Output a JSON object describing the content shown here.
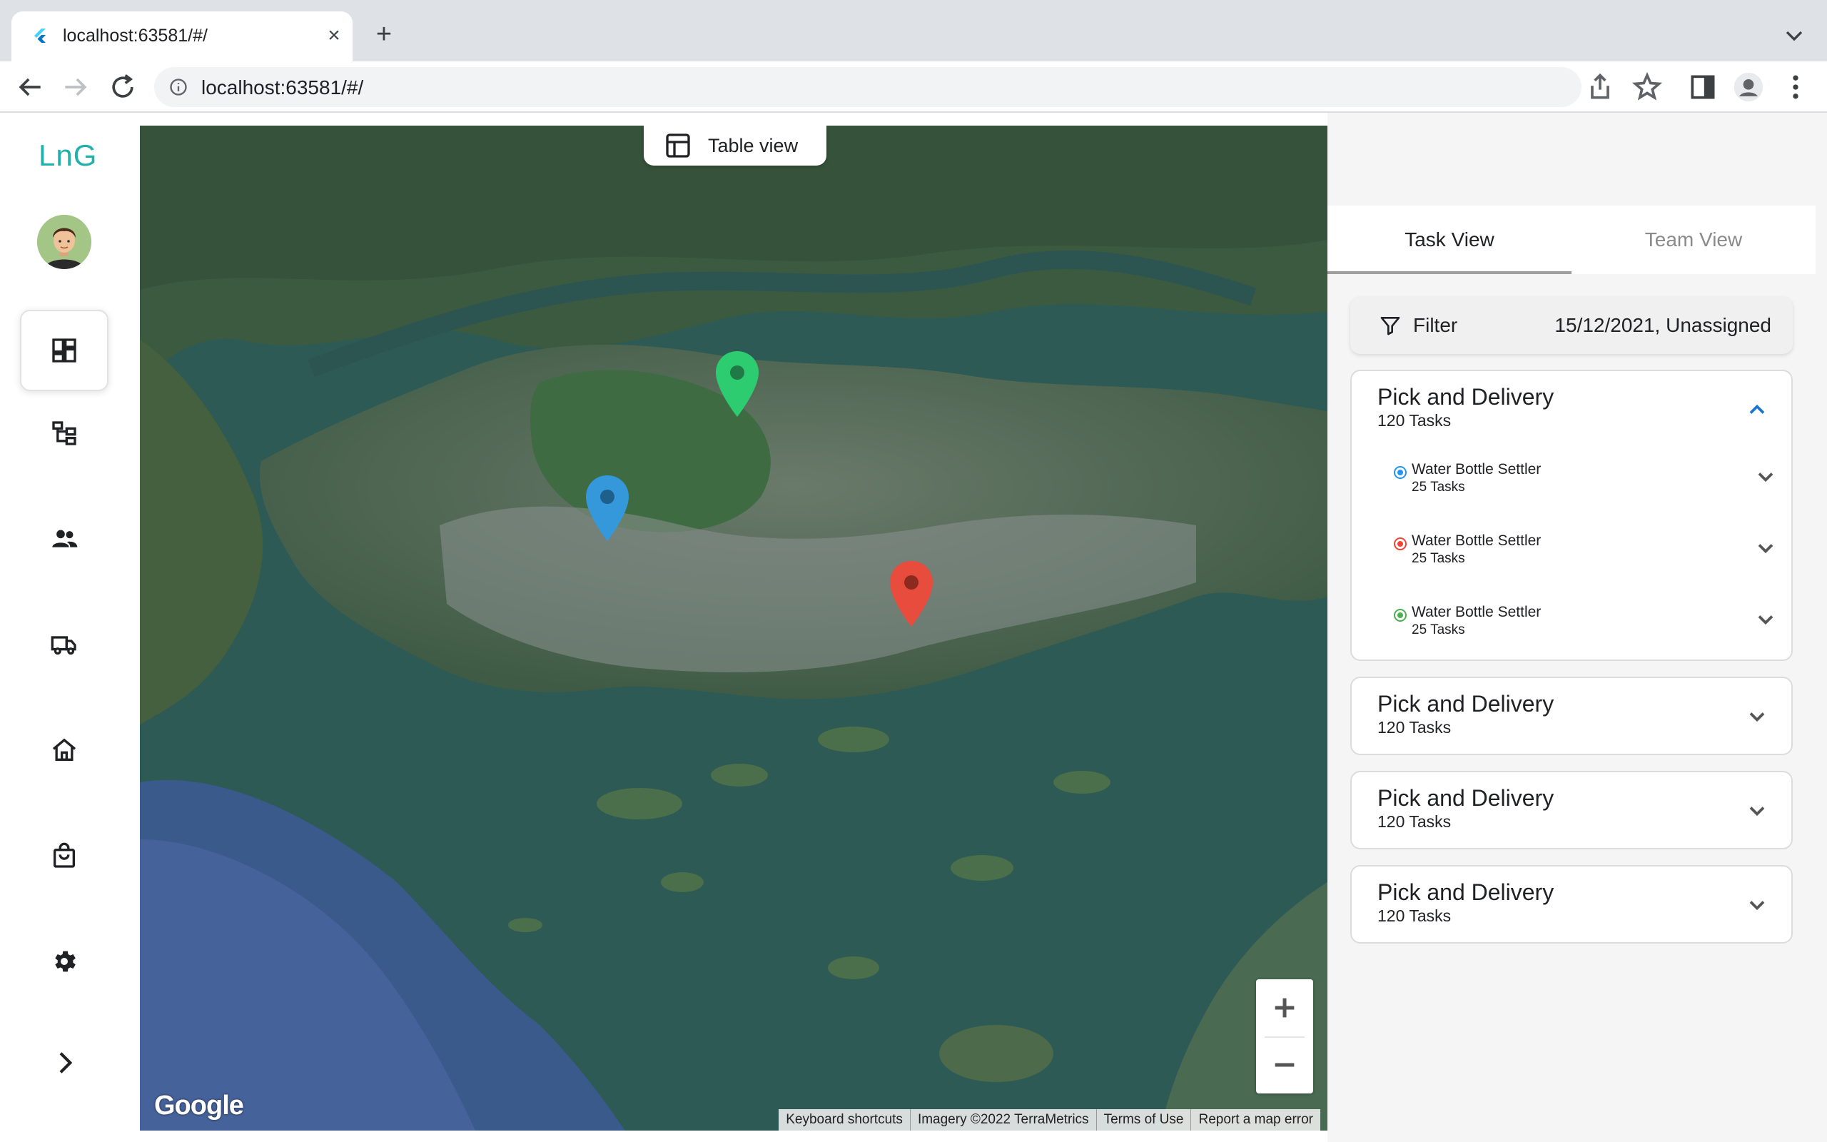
{
  "browser": {
    "tab_title": "localhost:63581/#/",
    "url": "localhost:63581/#/"
  },
  "app": {
    "logo": "LnG",
    "rail": [
      "dashboard-icon",
      "hierarchy-icon",
      "people-icon",
      "truck-icon",
      "home-icon",
      "shopping-bag-icon",
      "settings-icon",
      "expand-icon"
    ],
    "active_rail_index": 0
  },
  "map": {
    "table_view_label": "Table view",
    "google_label": "Google",
    "attribution": [
      "Keyboard shortcuts",
      "Imagery ©2022 TerraMetrics",
      "Terms of Use",
      "Report a map error"
    ],
    "pins": [
      {
        "color": "#2ecc71",
        "name": "green"
      },
      {
        "color": "#3498db",
        "name": "blue"
      },
      {
        "color": "#e74c3c",
        "name": "red"
      }
    ]
  },
  "panel": {
    "tabs": [
      "Task View",
      "Team View"
    ],
    "active_tab": "Task View",
    "filter_label": "Filter",
    "filter_value": "15/12/2021, Unassigned",
    "groups": [
      {
        "title": "Pick and Delivery",
        "subtitle": "120 Tasks",
        "expanded": true,
        "items": [
          {
            "title": "Water Bottle Settler",
            "subtitle": "25 Tasks",
            "color": "#2196f3"
          },
          {
            "title": "Water Bottle Settler",
            "subtitle": "25 Tasks",
            "color": "#f44336"
          },
          {
            "title": "Water Bottle Settler",
            "subtitle": "25 Tasks",
            "color": "#4caf50"
          }
        ]
      },
      {
        "title": "Pick and Delivery",
        "subtitle": "120 Tasks",
        "expanded": false
      },
      {
        "title": "Pick and Delivery",
        "subtitle": "120 Tasks",
        "expanded": false
      },
      {
        "title": "Pick and Delivery",
        "subtitle": "120 Tasks",
        "expanded": false
      }
    ]
  },
  "colors": {
    "accent": "#20b2aa",
    "chevron_expanded": "#1976d2"
  }
}
